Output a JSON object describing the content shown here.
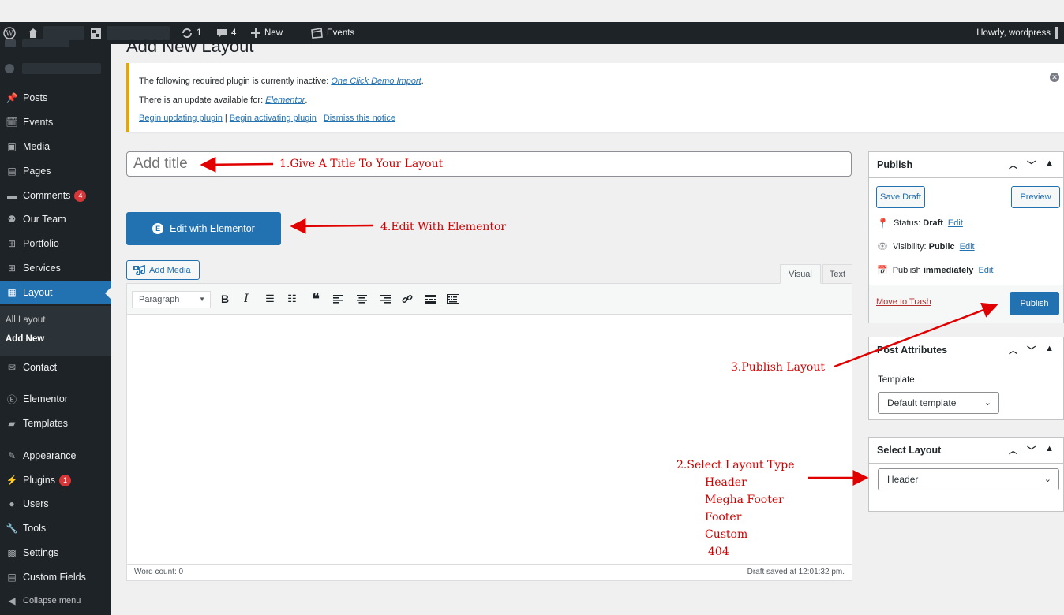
{
  "admin_bar": {
    "updates_count": "1",
    "comments_count": "4",
    "new_label": "New",
    "events_label": "Events",
    "howdy": "Howdy, wordpress"
  },
  "sidebar": {
    "items": [
      {
        "label": "Posts",
        "icon": "pin-icon"
      },
      {
        "label": "Events",
        "icon": "calendar-icon"
      },
      {
        "label": "Media",
        "icon": "media-icon"
      },
      {
        "label": "Pages",
        "icon": "pages-icon"
      },
      {
        "label": "Comments",
        "icon": "comment-icon",
        "badge": "4"
      },
      {
        "label": "Our Team",
        "icon": "team-icon"
      },
      {
        "label": "Portfolio",
        "icon": "grid-icon"
      },
      {
        "label": "Services",
        "icon": "grid-icon"
      },
      {
        "label": "Layout",
        "icon": "layout-icon"
      },
      {
        "label": "Contact",
        "icon": "mail-icon"
      },
      {
        "label": "Elementor",
        "icon": "elementor-icon"
      },
      {
        "label": "Templates",
        "icon": "folder-icon"
      },
      {
        "label": "Appearance",
        "icon": "brush-icon"
      },
      {
        "label": "Plugins",
        "icon": "plugin-icon",
        "badge": "1"
      },
      {
        "label": "Users",
        "icon": "user-icon"
      },
      {
        "label": "Tools",
        "icon": "wrench-icon"
      },
      {
        "label": "Settings",
        "icon": "settings-icon"
      },
      {
        "label": "Custom Fields",
        "icon": "fields-icon"
      },
      {
        "label": "Collapse menu",
        "icon": "collapse-icon"
      }
    ],
    "submenu": {
      "all": "All Layout",
      "add_new": "Add New"
    }
  },
  "page": {
    "title": "Add New Layout"
  },
  "notice": {
    "line1_prefix": "The following required plugin is currently inactive: ",
    "line1_link": "One Click Demo Import",
    "line2_prefix": "There is an update available for: ",
    "line2_link": "Elementor",
    "action_update": "Begin updating plugin",
    "action_activate": "Begin activating plugin",
    "action_dismiss": "Dismiss this notice",
    "separator": "|"
  },
  "editor": {
    "title_placeholder": "Add title",
    "elementor_button": "Edit with Elementor",
    "add_media": "Add Media",
    "tab_visual": "Visual",
    "tab_text": "Text",
    "format_select": "Paragraph",
    "word_count": "Word count: 0",
    "draft_saved": "Draft saved at 12:01:32 pm."
  },
  "publish_box": {
    "title": "Publish",
    "save_draft": "Save Draft",
    "preview": "Preview",
    "status_label": "Status: ",
    "status_value": "Draft",
    "visibility_label": "Visibility: ",
    "visibility_value": "Public",
    "publish_label": "Publish ",
    "publish_value": "immediately",
    "edit": "Edit",
    "move_to_trash": "Move to Trash",
    "publish_button": "Publish"
  },
  "attributes_box": {
    "title": "Post Attributes",
    "template_label": "Template",
    "template_value": "Default template"
  },
  "layout_box": {
    "title": "Select Layout",
    "value": "Header"
  },
  "annotations": {
    "step1": "1.Give A Title To Your Layout",
    "step2": "2.Select Layout Type",
    "step2_options": [
      "Header",
      "Megha Footer",
      "Footer",
      "Custom",
      "404"
    ],
    "step3": "3.Publish Layout",
    "step4": "4.Edit With Elementor"
  }
}
